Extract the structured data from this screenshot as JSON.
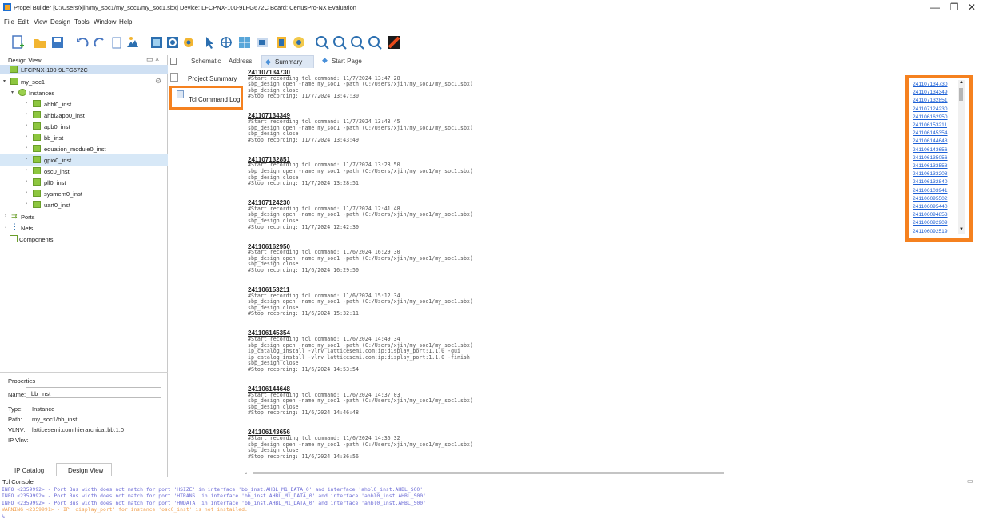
{
  "window": {
    "title": "Propel Builder  [C:/Users/xjin/my_soc1/my_soc1/my_soc1.sbx]   Device: LFCPNX-100-9LFG672C   Board: CertusPro-NX Evaluation",
    "minimize": "—",
    "maximize": "❐",
    "close": "✕"
  },
  "menu": [
    "File",
    "Edit",
    "View",
    "Design",
    "Tools",
    "Window",
    "Help"
  ],
  "toolbar_icons": [
    "new-icon",
    "open-icon",
    "save-icon",
    "undo-icon",
    "redo-icon",
    "copy-icon",
    "export-icon",
    "build-icon",
    "zoom-fit-icon",
    "gear-icon",
    "select-icon",
    "move-icon",
    "grid-icon",
    "pan-icon",
    "validate-icon",
    "settings-icon",
    "zoom-in-icon",
    "zoom-out-icon",
    "zoom-area-icon",
    "zoom-reset-icon",
    "report-icon"
  ],
  "design_view": {
    "title": "Design View",
    "device": "LFCPNX-100-9LFG672C",
    "root": "my_soc1",
    "instances_label": "Instances",
    "instances": [
      "ahbl0_inst",
      "ahbl2apb0_inst",
      "apb0_inst",
      "bb_inst",
      "equation_module0_inst",
      "gpio0_inst",
      "osc0_inst",
      "pll0_inst",
      "sysmem0_inst",
      "uart0_inst"
    ],
    "selected_instance": "gpio0_inst",
    "ports_label": "Ports",
    "nets_label": "Nets",
    "components_label": "Components"
  },
  "properties": {
    "title": "Properties",
    "name_label": "Name:",
    "name_value": "bb_inst",
    "type_label": "Type:",
    "type_value": "Instance",
    "path_label": "Path:",
    "path_value": "my_soc1/bb_inst",
    "vlnv_label": "VLNV:",
    "vlnv_value": "latticesemi.com:hierarchical:bb:1.0",
    "ipvlnv_label": "IP Vlnv:"
  },
  "bottom_tabs": [
    "IP Catalog",
    "Design View"
  ],
  "tabs": [
    "Schematic",
    "Address",
    "Summary",
    "Start Page"
  ],
  "active_tab": "Summary",
  "summary_nav": [
    "Project Summary",
    "Tcl Command Log"
  ],
  "log_entries": [
    {
      "id": "241107134730",
      "lines": [
        "#Start recording tcl command: 11/7/2024 13:47:28",
        "sbp_design open -name my_soc1 -path (C:/Users/xjin/my_soc1/my_soc1.sbx)",
        "sbp_design close",
        "#Stop recording: 11/7/2024 13:47:30"
      ]
    },
    {
      "id": "241107134349",
      "lines": [
        "#Start recording tcl command: 11/7/2024 13:43:45",
        "sbp_design open -name my_soc1 -path (C:/Users/xjin/my_soc1/my_soc1.sbx)",
        "sbp_design close",
        "#Stop recording: 11/7/2024 13:43:49"
      ]
    },
    {
      "id": "241107132851",
      "lines": [
        "#Start recording tcl command: 11/7/2024 13:28:50",
        "sbp_design open -name my_soc1 -path (C:/Users/xjin/my_soc1/my_soc1.sbx)",
        "sbp_design close",
        "#Stop recording: 11/7/2024 13:28:51"
      ]
    },
    {
      "id": "241107124230",
      "lines": [
        "#Start recording tcl command: 11/7/2024 12:41:48",
        "sbp_design open -name my_soc1 -path (C:/Users/xjin/my_soc1/my_soc1.sbx)",
        "sbp_design close",
        "#Stop recording: 11/7/2024 12:42:30"
      ]
    },
    {
      "id": "241106162950",
      "lines": [
        "#Start recording tcl command: 11/6/2024 16:29:30",
        "sbp_design open -name my_soc1 -path (C:/Users/xjin/my_soc1/my_soc1.sbx)",
        "sbp_design close",
        "#Stop recording: 11/6/2024 16:29:50"
      ]
    },
    {
      "id": "241106153211",
      "lines": [
        "#Start recording tcl command: 11/6/2024 15:12:34",
        "sbp_design open -name my_soc1 -path (C:/Users/xjin/my_soc1/my_soc1.sbx)",
        "sbp_design close",
        "#Stop recording: 11/6/2024 15:32:11"
      ]
    },
    {
      "id": "241106145354",
      "lines": [
        "#Start recording tcl command: 11/6/2024 14:49:34",
        "sbp_design open -name my_soc1 -path (C:/Users/xjin/my_soc1/my_soc1.sbx)",
        "ip_catalog_install -vlnv latticesemi.com:ip:display_port:1.1.0 -gui",
        "ip_catalog_install -vlnv latticesemi.com:ip:display_port:1.1.0 -finish",
        "sbp_design close",
        "#Stop recording: 11/6/2024 14:53:54"
      ]
    },
    {
      "id": "241106144648",
      "lines": [
        "#Start recording tcl command: 11/6/2024 14:37:03",
        "sbp_design open -name my_soc1 -path (C:/Users/xjin/my_soc1/my_soc1.sbx)",
        "sbp_design close",
        "#Stop recording: 11/6/2024 14:46:48"
      ]
    },
    {
      "id": "241106143656",
      "lines": [
        "#Start recording tcl command: 11/6/2024 14:36:32",
        "sbp_design open -name my_soc1 -path (C:/Users/xjin/my_soc1/my_soc1.sbx)",
        "sbp_design close",
        "#Stop recording: 11/6/2024 14:36:56"
      ]
    }
  ],
  "log_links": [
    "241107134730",
    "241107134349",
    "241107132851",
    "241107124230",
    "241106162950",
    "241106153211",
    "241106145354",
    "241106144648",
    "241106143656",
    "241106135056",
    "241106133558",
    "241106133208",
    "241106132840",
    "241106103941",
    "241106095502",
    "241106095440",
    "241106094853",
    "241106092909",
    "241106092519"
  ],
  "console": {
    "title": "Tcl Console",
    "lines": [
      {
        "text": "INFO <2359992> - Port Bus width does not match for port 'HSIZE' in interface 'bb_inst.AHBL_M1_DATA_0' and interface 'ahbl0_inst.AHBL_S00'",
        "level": "info"
      },
      {
        "text": "INFO <2359992> - Port Bus width does not match for port 'HTRANS' in interface 'bb_inst.AHBL_M1_DATA_0' and interface 'ahbl0_inst.AHBL_S00'",
        "level": "info"
      },
      {
        "text": "INFO <2359992> - Port Bus width does not match for port 'HWDATA' in interface 'bb_inst.AHBL_M1_DATA_0' and interface 'ahbl0_inst.AHBL_S00'",
        "level": "info"
      },
      {
        "text": "WARNING <2359991> - IP 'display_port' for instance 'osc0_inst' is not installed.",
        "level": "warning"
      },
      {
        "text": "%",
        "level": "prompt"
      }
    ],
    "colors": {
      "info": "#6b6bd6",
      "warning": "#f0a050",
      "prompt": "#6b6bd6"
    }
  },
  "colors": {
    "highlight": "#f5811f",
    "link": "#1c5fd4",
    "selection": "#d7e8f7",
    "instance_green": "#8dc63f"
  }
}
